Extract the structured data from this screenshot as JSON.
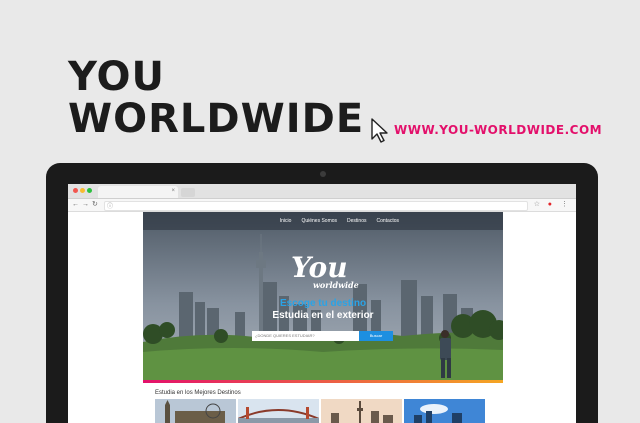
{
  "promo": {
    "title_line1": "YOU",
    "title_line2": "WORLDWIDE",
    "url": "WWW.YOU-WORLDWIDE.COM",
    "url_color": "#e3106b"
  },
  "browser": {
    "tab_close": "×",
    "icons": {
      "back": "arrow-left-icon",
      "forward": "arrow-right-icon",
      "reload": "reload-icon",
      "info": "info-icon",
      "star": "star-icon",
      "opera": "opera-icon",
      "menu": "menu-icon"
    }
  },
  "site": {
    "nav": [
      "Inicio",
      "Quiénes Somos",
      "Destinos",
      "Contactos"
    ],
    "logo_main": "You",
    "logo_sub": "worldwide",
    "tagline1": "Escoge tu destino",
    "tagline2": "Estudia en el exterior",
    "search_placeholder": "¿DONDE QUIERES ESTUDIAR?",
    "search_button": "Buscar",
    "section_title": "Estudia en los Mejores Destinos",
    "accent_color": "#1d8fe0"
  }
}
